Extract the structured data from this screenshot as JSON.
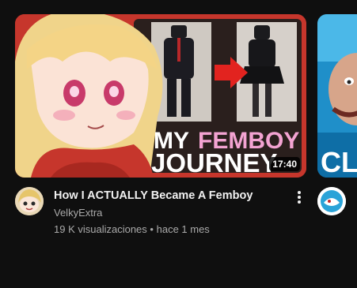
{
  "video": {
    "title": "How I ACTUALLY Became A Femboy",
    "channel": "VelkyExtra",
    "views": "19 K visualizaciones",
    "separator": "•",
    "age": "hace 1 mes",
    "duration": "17:40",
    "thumbnail_text_line1_a": "MY",
    "thumbnail_text_line1_b": "FEMBOY",
    "thumbnail_text_line2": "JOURNEY"
  },
  "next_video": {
    "thumbnail_text": "CL"
  },
  "colors": {
    "background": "#0f0f0f",
    "title": "#f1f1f1",
    "secondary_text": "#aaaaaa",
    "thumbnail_border": "#c6362c",
    "femboy_pink": "#f3a3d2"
  },
  "icons": {
    "more": "more-vert-icon",
    "arrow": "red-arrow-icon"
  }
}
